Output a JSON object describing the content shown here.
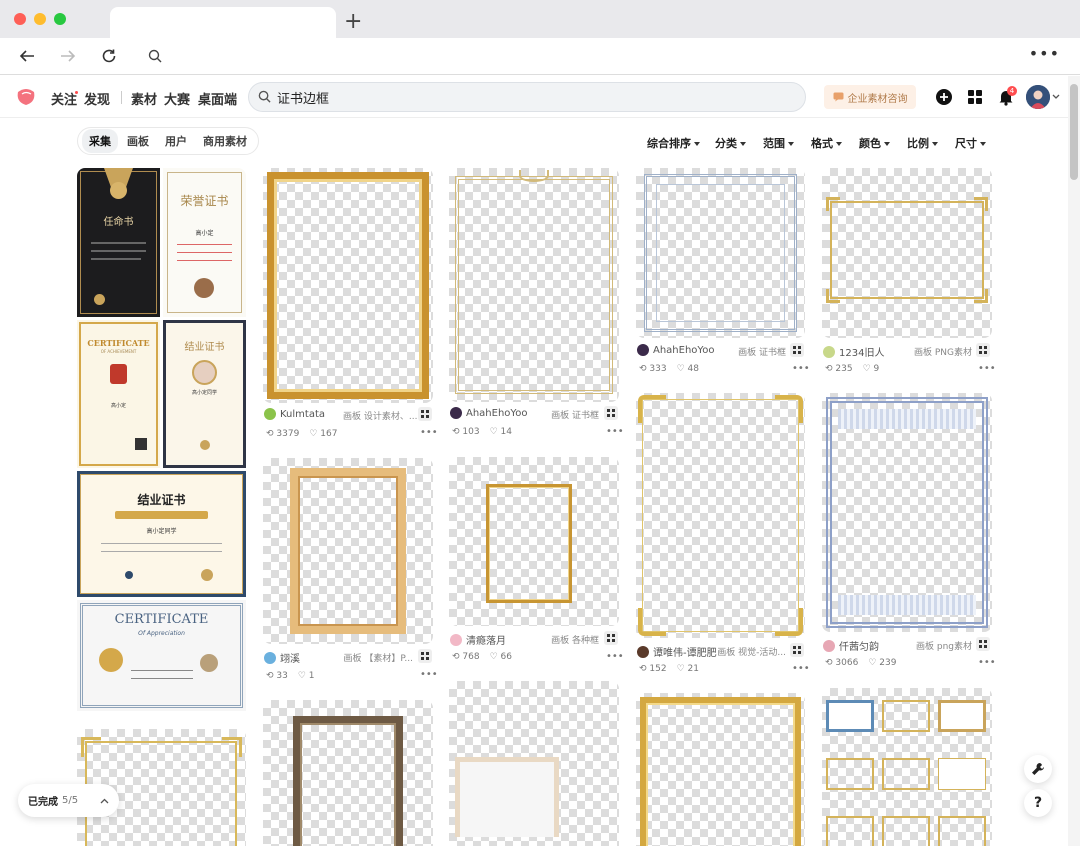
{
  "header": {
    "nav_follow": "关注",
    "nav_discover": "发现",
    "nav_material": "素材",
    "nav_contest": "大赛",
    "nav_desktop": "桌面端",
    "search_value": "证书边框",
    "enterprise_btn": "企业素材咨询",
    "notification_count": "4"
  },
  "seg_tabs": [
    "采集",
    "画板",
    "用户",
    "商用素材"
  ],
  "filters": [
    "综合排序",
    "分类",
    "范围",
    "格式",
    "颜色",
    "比例",
    "尺寸"
  ],
  "col1": {
    "cert1_title": "任命书",
    "cert2_title": "荣誉证书",
    "cert2_name": "高小定",
    "cert3_title": "CERTIFICATE",
    "cert3_sub": "OF ACHIEVEMENT",
    "cert3_name": "高小定",
    "cert4_title": "结业证书",
    "cert4_name": "高小定同学",
    "cert5_title": "结业证书",
    "cert5_name": "高小定同学",
    "cert6_title": "CERTIFICATE",
    "cert6_sub": "Of Appreciation"
  },
  "pins": {
    "p1": {
      "user": "Kulmtata",
      "board": "画板 设计素材、...",
      "saves": "3379",
      "likes": "167"
    },
    "p2": {
      "user": "AhahEhoYoo",
      "board": "画板 证书框",
      "saves": "103",
      "likes": "14"
    },
    "p3": {
      "user": "AhahEhoYoo",
      "board": "画板 证书框",
      "saves": "333",
      "likes": "48"
    },
    "p4": {
      "user": "1234旧人",
      "board": "画板 PNG素材",
      "saves": "235",
      "likes": "9"
    },
    "p5": {
      "user": "翊溪",
      "board": "画板 【素材】P...",
      "saves": "33",
      "likes": "1"
    },
    "p6": {
      "user": "清瘾落月",
      "board": "画板 各种框",
      "saves": "768",
      "likes": "66"
    },
    "p7": {
      "user": "谭唯伟-谭肥肥",
      "board": "画板 视觉-活动...",
      "saves": "152",
      "likes": "21"
    },
    "p8": {
      "user": "仟茜匀韵",
      "board": "画板 png素材",
      "saves": "3066",
      "likes": "239"
    }
  },
  "status": {
    "label": "已完成",
    "progress": "5/5"
  }
}
